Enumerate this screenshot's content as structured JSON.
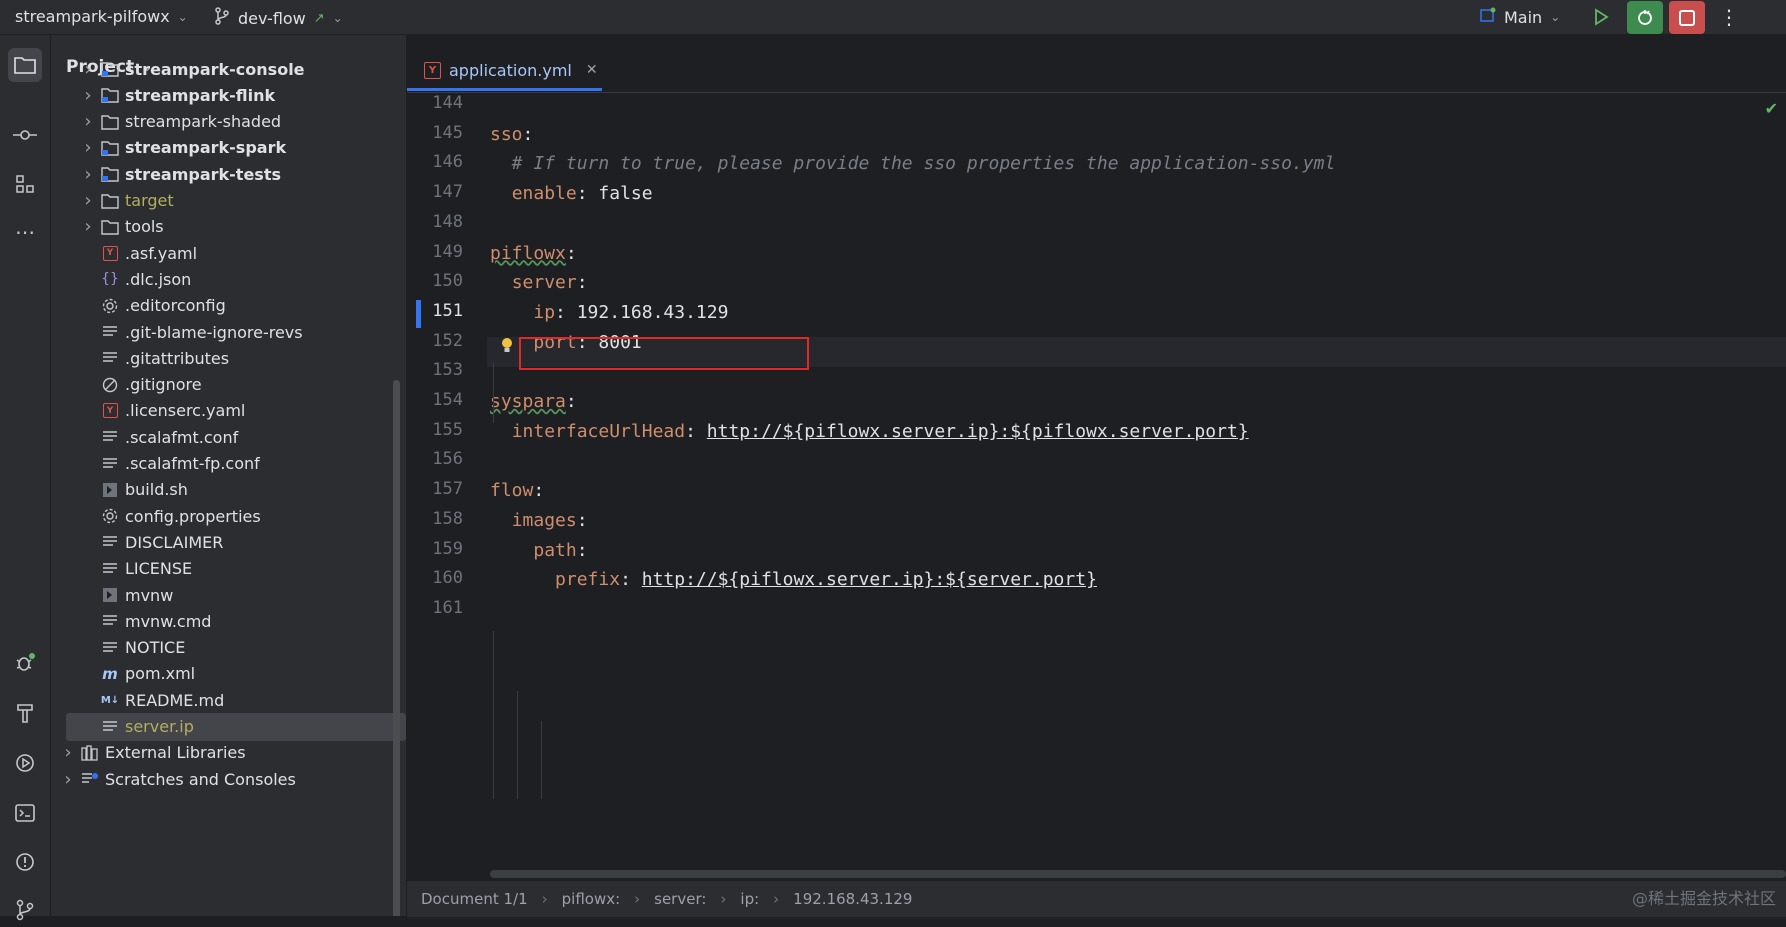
{
  "titlebar": {
    "project": "streampark-pilfowx",
    "branch": "dev-flow",
    "run_config": "Main"
  },
  "colors": {
    "accent": "#3574f0",
    "debug_bg": "#3d8b4f",
    "stop_bg": "#c94f4f",
    "highlight": "#e02a2a",
    "key": "#cf8e6d",
    "comment": "#7a7e85"
  },
  "project_panel": {
    "title": "Project",
    "items": [
      {
        "label": "streampark-console",
        "type": "module-folder",
        "bold": true,
        "expandable": true,
        "level": 1
      },
      {
        "label": "streampark-flink",
        "type": "module-folder",
        "bold": true,
        "expandable": true,
        "level": 1
      },
      {
        "label": "streampark-shaded",
        "type": "folder",
        "bold": false,
        "expandable": true,
        "level": 1
      },
      {
        "label": "streampark-spark",
        "type": "module-folder",
        "bold": true,
        "expandable": true,
        "level": 1
      },
      {
        "label": "streampark-tests",
        "type": "module-folder",
        "bold": true,
        "expandable": true,
        "level": 1
      },
      {
        "label": "target",
        "type": "folder",
        "olive": true,
        "expandable": true,
        "level": 1
      },
      {
        "label": "tools",
        "type": "folder",
        "expandable": true,
        "level": 1
      },
      {
        "label": ".asf.yaml",
        "type": "yaml",
        "level": 1
      },
      {
        "label": ".dlc.json",
        "type": "json",
        "level": 1
      },
      {
        "label": ".editorconfig",
        "type": "gear",
        "level": 1
      },
      {
        "label": ".git-blame-ignore-revs",
        "type": "text",
        "level": 1
      },
      {
        "label": ".gitattributes",
        "type": "text",
        "level": 1
      },
      {
        "label": ".gitignore",
        "type": "ignore",
        "level": 1
      },
      {
        "label": ".licenserc.yaml",
        "type": "yaml",
        "level": 1
      },
      {
        "label": ".scalafmt.conf",
        "type": "text",
        "level": 1
      },
      {
        "label": ".scalafmt-fp.conf",
        "type": "text",
        "level": 1
      },
      {
        "label": "build.sh",
        "type": "shell",
        "level": 1
      },
      {
        "label": "config.properties",
        "type": "gear",
        "level": 1
      },
      {
        "label": "DISCLAIMER",
        "type": "text",
        "level": 1
      },
      {
        "label": "LICENSE",
        "type": "text",
        "level": 1
      },
      {
        "label": "mvnw",
        "type": "shell",
        "level": 1
      },
      {
        "label": "mvnw.cmd",
        "type": "text",
        "level": 1
      },
      {
        "label": "NOTICE",
        "type": "text",
        "level": 1
      },
      {
        "label": "pom.xml",
        "type": "maven",
        "level": 1
      },
      {
        "label": "README.md",
        "type": "markdown",
        "level": 1
      },
      {
        "label": "server.ip",
        "type": "text",
        "olive": true,
        "selected": true,
        "level": 1
      },
      {
        "label": "External Libraries",
        "type": "library",
        "expandable": true,
        "level": 0
      },
      {
        "label": "Scratches and Consoles",
        "type": "scratch",
        "expandable": true,
        "level": 0
      }
    ]
  },
  "editor": {
    "tab_label": "application.yml",
    "current_line": 151,
    "lines": [
      {
        "n": "144",
        "parts": []
      },
      {
        "n": "145",
        "parts": [
          {
            "t": "sso",
            "c": "k"
          },
          {
            "t": ":",
            "c": "p"
          }
        ]
      },
      {
        "n": "146",
        "parts": [
          {
            "t": "  # If turn to true, please provide the sso properties the application-sso.yml",
            "c": "c"
          }
        ]
      },
      {
        "n": "147",
        "parts": [
          {
            "t": "  ",
            "c": "p"
          },
          {
            "t": "enable",
            "c": "k"
          },
          {
            "t": ": false",
            "c": "v"
          }
        ]
      },
      {
        "n": "148",
        "parts": []
      },
      {
        "n": "149",
        "parts": [
          {
            "t": "piflowx",
            "c": "k sq"
          },
          {
            "t": ":",
            "c": "p"
          }
        ]
      },
      {
        "n": "150",
        "parts": [
          {
            "t": "  ",
            "c": "p"
          },
          {
            "t": "server",
            "c": "k"
          },
          {
            "t": ":",
            "c": "p"
          }
        ]
      },
      {
        "n": "151",
        "parts": [
          {
            "t": "    ",
            "c": "p"
          },
          {
            "t": "ip",
            "c": "k"
          },
          {
            "t": ": 192.168.43.129",
            "c": "v"
          }
        ]
      },
      {
        "n": "152",
        "parts": [
          {
            "t": "    ",
            "c": "p"
          },
          {
            "t": "port",
            "c": "k"
          },
          {
            "t": ": 8001",
            "c": "v"
          }
        ]
      },
      {
        "n": "153",
        "parts": []
      },
      {
        "n": "154",
        "parts": [
          {
            "t": "syspara",
            "c": "k sq"
          },
          {
            "t": ":",
            "c": "p"
          }
        ]
      },
      {
        "n": "155",
        "parts": [
          {
            "t": "  ",
            "c": "p"
          },
          {
            "t": "interfaceUrlHead",
            "c": "k"
          },
          {
            "t": ": ",
            "c": "p"
          },
          {
            "t": "http://${piflowx.server.ip}:${piflowx.server.port}",
            "c": "u"
          }
        ]
      },
      {
        "n": "156",
        "parts": []
      },
      {
        "n": "157",
        "parts": [
          {
            "t": "flow",
            "c": "k"
          },
          {
            "t": ":",
            "c": "p"
          }
        ]
      },
      {
        "n": "158",
        "parts": [
          {
            "t": "  ",
            "c": "p"
          },
          {
            "t": "images",
            "c": "k"
          },
          {
            "t": ":",
            "c": "p"
          }
        ]
      },
      {
        "n": "159",
        "parts": [
          {
            "t": "    ",
            "c": "p"
          },
          {
            "t": "path",
            "c": "k"
          },
          {
            "t": ":",
            "c": "p"
          }
        ]
      },
      {
        "n": "160",
        "parts": [
          {
            "t": "      ",
            "c": "p"
          },
          {
            "t": "prefix",
            "c": "k"
          },
          {
            "t": ": ",
            "c": "p"
          },
          {
            "t": "http://${piflowx.server.ip}:${server.port}",
            "c": "u"
          }
        ]
      },
      {
        "n": "161",
        "parts": []
      }
    ]
  },
  "statusbar": {
    "breadcrumbs": [
      "Document 1/1",
      "piflowx:",
      "server:",
      "ip:",
      "192.168.43.129"
    ]
  },
  "watermark": "@稀土掘金技术社区"
}
